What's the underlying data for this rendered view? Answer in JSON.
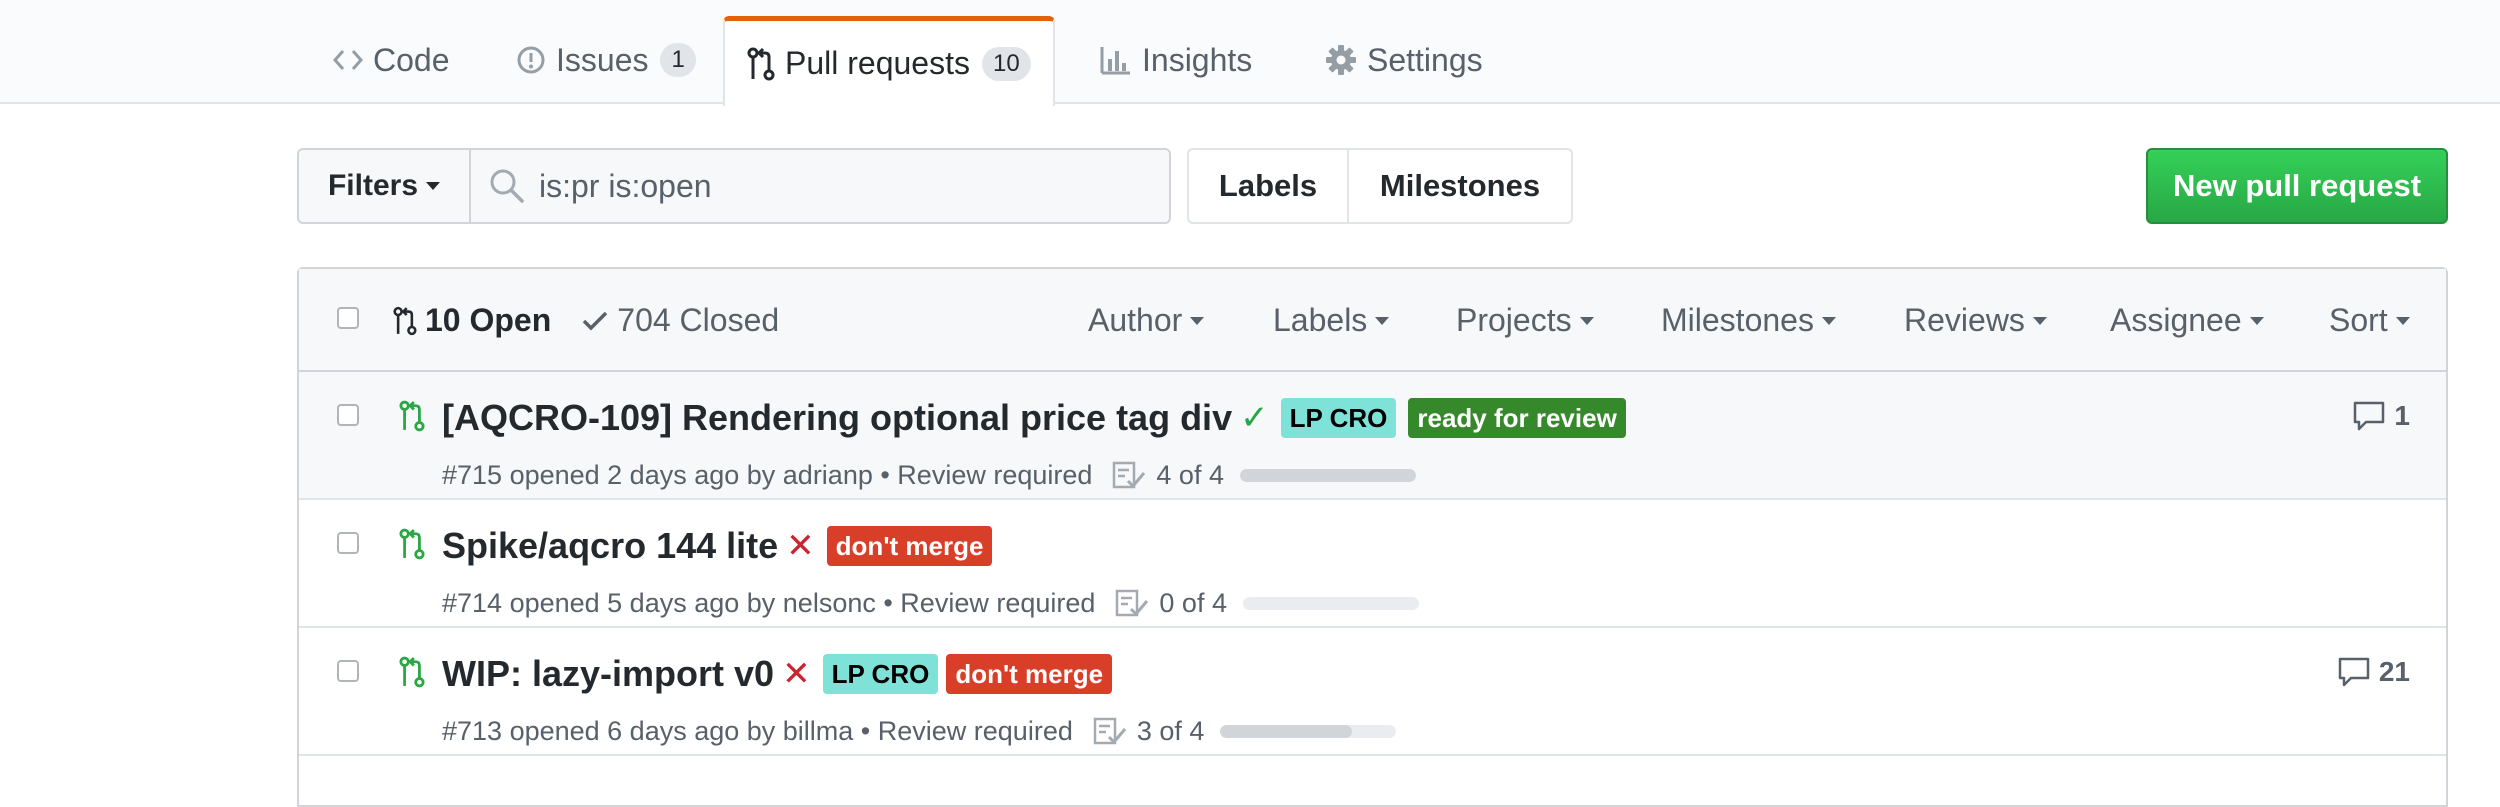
{
  "tabs": [
    {
      "label": "Code",
      "icon": "code-icon"
    },
    {
      "label": "Issues",
      "icon": "issue-opened-icon",
      "count": "1"
    },
    {
      "label": "Pull requests",
      "icon": "git-pull-request-icon",
      "count": "10",
      "selected": true
    },
    {
      "label": "Insights",
      "icon": "graph-icon"
    },
    {
      "label": "Settings",
      "icon": "gear-icon"
    }
  ],
  "subnav": {
    "filters_label": "Filters",
    "search_value": "is:pr is:open",
    "labels_label": "Labels",
    "milestones_label": "Milestones",
    "new_pr_label": "New pull request"
  },
  "list_header": {
    "open_label": "10 Open",
    "closed_label": "704 Closed",
    "filters": [
      "Author",
      "Labels",
      "Projects",
      "Milestones",
      "Reviews",
      "Assignee",
      "Sort"
    ]
  },
  "pull_requests": [
    {
      "title": "[AQCRO-109] Rendering optional price tag div",
      "status": "success",
      "status_glyph": "✓",
      "labels": [
        {
          "name": "LP CRO",
          "bg": "#7ee2d9",
          "fg": "#000000"
        },
        {
          "name": "ready for review",
          "bg": "#36892b",
          "fg": "#ffffff"
        }
      ],
      "meta": "#715 opened 2 days ago by adrianp • Review required",
      "tasks": "4 of 4",
      "progress": 1.0,
      "comments": "1"
    },
    {
      "title": "Spike/aqcro 144 lite",
      "status": "failure",
      "status_glyph": "✕",
      "labels": [
        {
          "name": "don't merge",
          "bg": "#d93f28",
          "fg": "#ffffff"
        }
      ],
      "meta": "#714 opened 5 days ago by nelsonc • Review required",
      "tasks": "0 of 4",
      "progress": 0.0,
      "comments": ""
    },
    {
      "title": "WIP: lazy-import v0",
      "status": "failure",
      "status_glyph": "✕",
      "labels": [
        {
          "name": "LP CRO",
          "bg": "#7ee2d9",
          "fg": "#000000"
        },
        {
          "name": "don't merge",
          "bg": "#d93f28",
          "fg": "#ffffff"
        }
      ],
      "meta": "#713 opened 6 days ago by billma • Review required",
      "tasks": "3 of 4",
      "progress": 0.75,
      "comments": "21"
    }
  ],
  "colors": {
    "accent_tab": "#e36209",
    "success": "#28a745",
    "failure": "#cb2431",
    "pr_open": "#28a745"
  }
}
